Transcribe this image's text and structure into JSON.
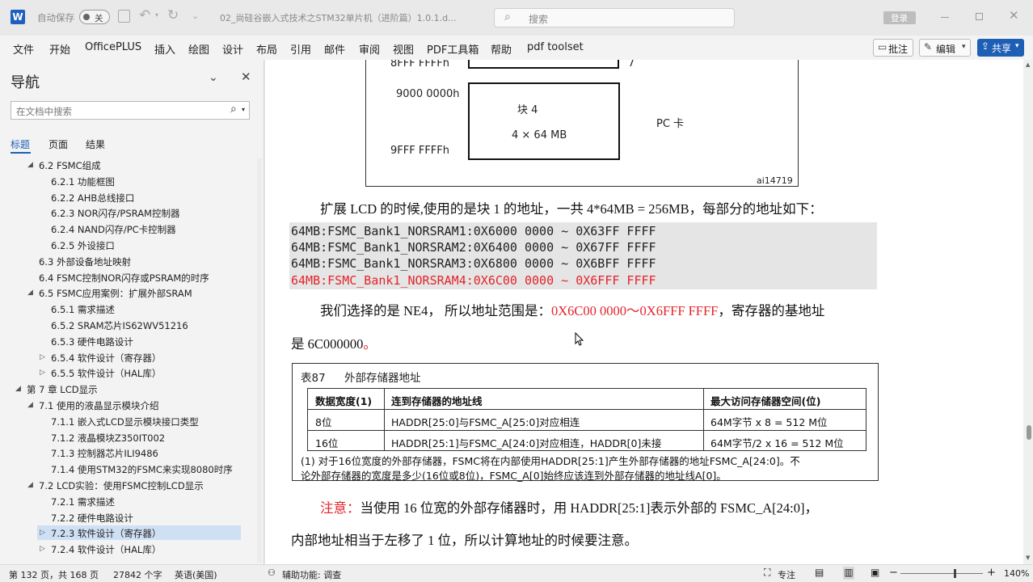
{
  "titlebar": {
    "autosave_label": "自动保存",
    "autosave_state": "关",
    "doc_title": "02_尚硅谷嵌入式技术之STM32单片机（进阶篇）1.0.1.d...",
    "search_placeholder": "搜索",
    "login_label": "登录"
  },
  "menu": {
    "items": [
      "文件",
      "开始",
      "OfficePLUS",
      "插入",
      "绘图",
      "设计",
      "布局",
      "引用",
      "邮件",
      "审阅",
      "视图",
      "PDF工具箱",
      "帮助",
      "pdf toolset"
    ],
    "comment_label": "批注",
    "edit_label": "编辑",
    "share_label": "共享"
  },
  "nav": {
    "title": "导航",
    "search_placeholder": "在文档中搜索",
    "tabs": [
      "标题",
      "页面",
      "结果"
    ],
    "items": [
      {
        "label": "6.2 FSMC组成",
        "level": 2,
        "tri": "open"
      },
      {
        "label": "6.2.1 功能框图",
        "level": 3,
        "tri": ""
      },
      {
        "label": "6.2.2 AHB总线接口",
        "level": 3,
        "tri": ""
      },
      {
        "label": "6.2.3 NOR闪存/PSRAM控制器",
        "level": 3,
        "tri": ""
      },
      {
        "label": "6.2.4 NAND闪存/PC卡控制器",
        "level": 3,
        "tri": ""
      },
      {
        "label": "6.2.5 外设接口",
        "level": 3,
        "tri": ""
      },
      {
        "label": "6.3 外部设备地址映射",
        "level": 2,
        "tri": ""
      },
      {
        "label": "6.4 FSMC控制NOR闪存或PSRAM的时序",
        "level": 2,
        "tri": ""
      },
      {
        "label": "6.5 FSMC应用案例：扩展外部SRAM",
        "level": 2,
        "tri": "open"
      },
      {
        "label": "6.5.1 需求描述",
        "level": 3,
        "tri": ""
      },
      {
        "label": "6.5.2 SRAM芯片IS62WV51216",
        "level": 3,
        "tri": ""
      },
      {
        "label": "6.5.3 硬件电路设计",
        "level": 3,
        "tri": ""
      },
      {
        "label": "6.5.4 软件设计（寄存器）",
        "level": 3,
        "tri": "closed"
      },
      {
        "label": "6.5.5 软件设计（HAL库）",
        "level": 3,
        "tri": "closed"
      },
      {
        "label": "第 7 章 LCD显示",
        "level": 1,
        "tri": "open"
      },
      {
        "label": "7.1 使用的液晶显示模块介绍",
        "level": 2,
        "tri": "open"
      },
      {
        "label": "7.1.1 嵌入式LCD显示模块接口类型",
        "level": 3,
        "tri": ""
      },
      {
        "label": "7.1.2 液晶模块Z350IT002",
        "level": 3,
        "tri": ""
      },
      {
        "label": "7.1.3 控制器芯片ILI9486",
        "level": 3,
        "tri": ""
      },
      {
        "label": "7.1.4 使用STM32的FSMC来实现8080时序",
        "level": 3,
        "tri": ""
      },
      {
        "label": "7.2 LCD实验：使用FSMC控制LCD显示",
        "level": 2,
        "tri": "open"
      },
      {
        "label": "7.2.1 需求描述",
        "level": 3,
        "tri": ""
      },
      {
        "label": "7.2.2 硬件电路设计",
        "level": 3,
        "tri": ""
      },
      {
        "label": "7.2.3 软件设计（寄存器）",
        "level": 3,
        "tri": "closed",
        "selected": true
      },
      {
        "label": "7.2.4 软件设计（HAL库）",
        "level": 3,
        "tri": "closed"
      }
    ]
  },
  "figure": {
    "addr_top": "8FFF FFFFh",
    "addr_9000": "9000 0000h",
    "addr_9fff": "9FFF FFFFh",
    "block_label": "块 4",
    "block_size": "4 × 64 MB",
    "pc_card": "PC 卡",
    "fig_id": "ai14719",
    "seven": "7"
  },
  "body": {
    "para1": "扩展 LCD 的时候,使用的是块 1 的地址，一共 4*64MB = 256MB，每部分的地址如下：",
    "code": [
      "64MB:FSMC_Bank1_NORSRAM1:0X6000 0000 ~ 0X63FF FFFF",
      "64MB:FSMC_Bank1_NORSRAM2:0X6400 0000 ~ 0X67FF FFFF",
      "64MB:FSMC_Bank1_NORSRAM3:0X6800 0000 ~ 0X6BFF FFFF",
      "64MB:FSMC_Bank1_NORSRAM4:0X6C00 0000 ~ 0X6FFF FFFF"
    ],
    "para2_a": "我们选择的是 NE4，  所以地址范围是：",
    "para2_red": "0X6C00 0000～0X6FFF FFFF",
    "para2_b": "，寄存器的基地址",
    "para3_a": "是 6C000000",
    "para3_red": "。",
    "note_label": "注意：",
    "note_text": "当使用 16 位宽的外部存储器时，用 HADDR[25:1]表示外部的 FSMC_A[24:0]，",
    "note_text2": "内部地址相当于左移了 1 位，所以计算地址的时候要注意。"
  },
  "table": {
    "caption_num": "表87",
    "caption_text": "外部存储器地址",
    "headers": [
      "数据宽度(1)",
      "连到存储器的地址线",
      "最大访问存储器空间(位)"
    ],
    "rows": [
      [
        "8位",
        "HADDR[25:0]与FSMC_A[25:0]对应相连",
        "64M字节 x 8 = 512 M位"
      ],
      [
        "16位",
        "HADDR[25:1]与FSMC_A[24:0]对应相连，HADDR[0]未接",
        "64M字节/2 x 16 = 512 M位"
      ]
    ],
    "footnote1": "(1)  对于16位宽度的外部存储器，FSMC将在内部使用HADDR[25:1]产生外部存储器的地址FSMC_A[24:0]。不",
    "footnote2": "论外部存储器的宽度是多少(16位或8位)，FSMC_A[0]始终应该连到外部存储器的地址线A[0]。"
  },
  "status": {
    "page": "第 132 页，共 168 页",
    "words": "27842 个字",
    "lang": "英语(美国)",
    "accessibility": "辅助功能: 调查",
    "focus": "专注",
    "zoom": "140%"
  }
}
